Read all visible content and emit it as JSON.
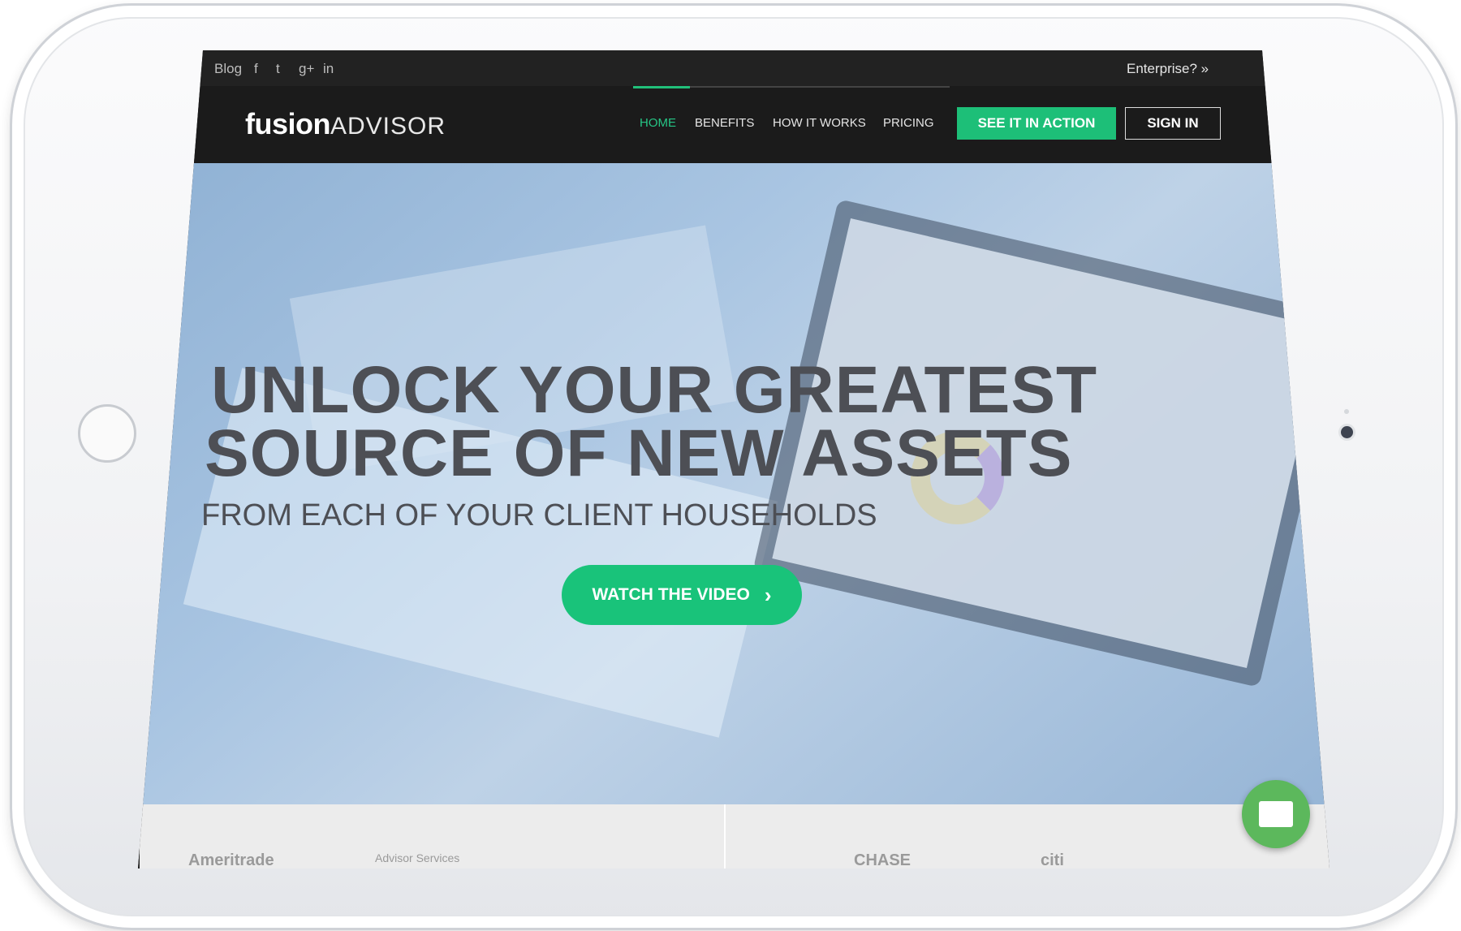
{
  "topbar": {
    "blog": "Blog",
    "social": [
      "f",
      "t",
      "g+",
      "in"
    ],
    "enterprise": "Enterprise? »"
  },
  "nav": {
    "logo_bold": "fusion",
    "logo_light": "ADVISOR",
    "links": [
      "HOME",
      "BENEFITS",
      "HOW IT WORKS",
      "PRICING"
    ],
    "cta": "SEE IT IN ACTION",
    "signin": "SIGN IN"
  },
  "hero": {
    "line1": "UNLOCK YOUR GREATEST",
    "line2": "SOURCE OF NEW ASSETS",
    "sub": "FROM EACH OF YOUR CLIENT HOUSEHOLDS",
    "button": "WATCH THE VIDEO",
    "button_icon": "chevron-right-icon"
  },
  "partners": [
    "Ameritrade",
    "Advisor Services",
    "CHASE",
    "citi"
  ],
  "colors": {
    "accent": "#1dbf78",
    "nav_bg": "#1b1b1b",
    "topbar_bg": "#222222"
  }
}
